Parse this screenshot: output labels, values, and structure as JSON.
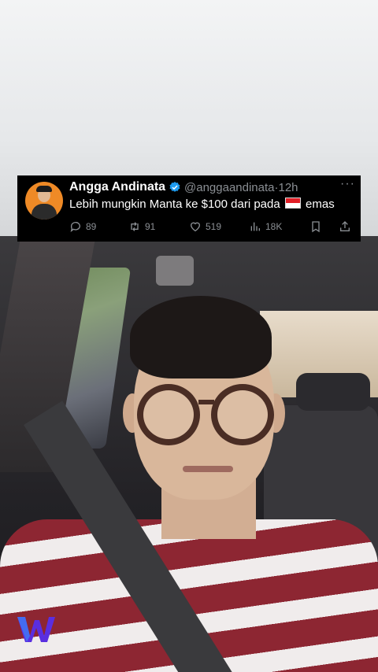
{
  "tweet": {
    "author_name": "Angga Andinata",
    "handle": "@anggaandinata",
    "separator": "·",
    "time": "12h",
    "more_icon": "more-dots-icon",
    "text_before_flag": "Lebih mungkin Manta ke $100 dari pada",
    "flag": "indonesia-flag",
    "text_after_flag": "emas",
    "replies": "89",
    "retweets": "91",
    "likes": "519",
    "views": "18K",
    "accent": "#1d9bf0"
  },
  "brand": {
    "logo_icon": "w-logo-icon",
    "logo_color": "#5a2ee0"
  }
}
